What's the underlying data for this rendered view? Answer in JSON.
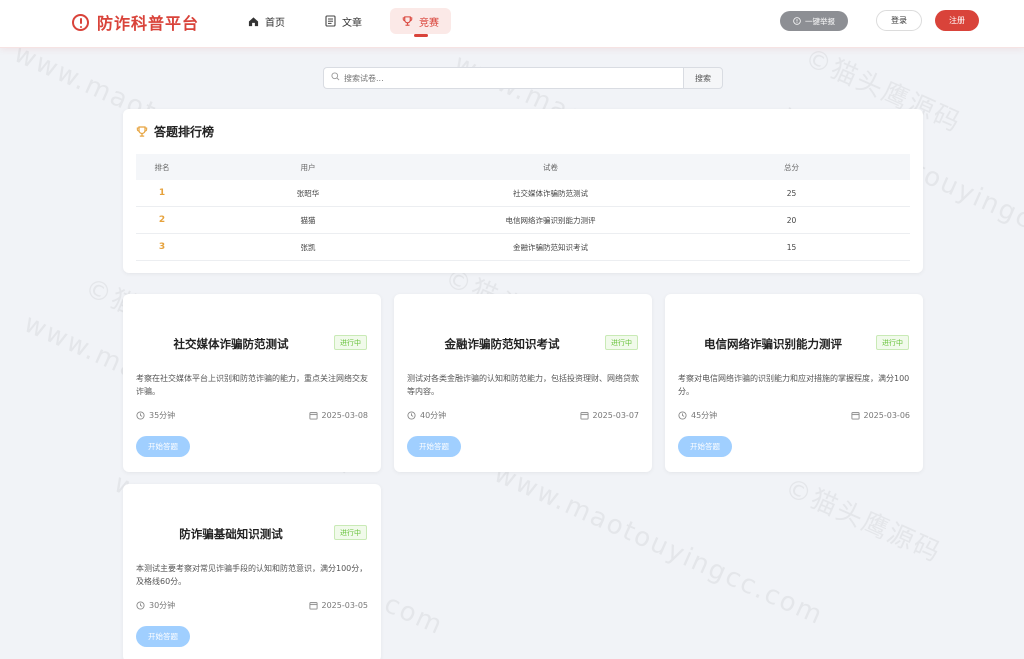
{
  "header": {
    "logo_text": "防诈科普平台",
    "nav": [
      {
        "label": "首页",
        "icon": "home-icon"
      },
      {
        "label": "文章",
        "icon": "document-icon"
      },
      {
        "label": "竞赛",
        "icon": "trophy-icon",
        "active": true
      }
    ],
    "report_label": "一键举报",
    "login_label": "登录",
    "register_label": "注册"
  },
  "search": {
    "placeholder": "搜索试卷...",
    "button_label": "搜索"
  },
  "ranking": {
    "title": "答题排行榜",
    "columns": [
      "排名",
      "用户",
      "试卷",
      "总分"
    ],
    "rows": [
      {
        "rank": "1",
        "user": "张昭华",
        "paper": "社交媒体诈骗防范测试",
        "score": "25"
      },
      {
        "rank": "2",
        "user": "猫猫",
        "paper": "电信网络诈骗识别能力测评",
        "score": "20"
      },
      {
        "rank": "3",
        "user": "张凯",
        "paper": "金融诈骗防范知识考试",
        "score": "15"
      }
    ]
  },
  "cards": [
    {
      "title": "社交媒体诈骗防范测试",
      "status": "进行中",
      "desc": "考察在社交媒体平台上识别和防范诈骗的能力，重点关注网络交友诈骗。",
      "duration": "35分钟",
      "date": "2025-03-08",
      "button": "开始答题"
    },
    {
      "title": "金融诈骗防范知识考试",
      "status": "进行中",
      "desc": "测试对各类金融诈骗的认知和防范能力，包括投资理财、网络贷款等内容。",
      "duration": "40分钟",
      "date": "2025-03-07",
      "button": "开始答题"
    },
    {
      "title": "电信网络诈骗识别能力测评",
      "status": "进行中",
      "desc": "考察对电信网络诈骗的识别能力和应对措施的掌握程度，满分100分。",
      "duration": "45分钟",
      "date": "2025-03-06",
      "button": "开始答题"
    },
    {
      "title": "防诈骗基础知识测试",
      "status": "进行中",
      "desc": "本测试主要考察对常见诈骗手段的认知和防范意识，满分100分，及格线60分。",
      "duration": "30分钟",
      "date": "2025-03-05",
      "button": "开始答题"
    }
  ],
  "watermark": {
    "url_text": "www.maotouyingcc.com",
    "brand_text": "©猫头鹰源码"
  }
}
